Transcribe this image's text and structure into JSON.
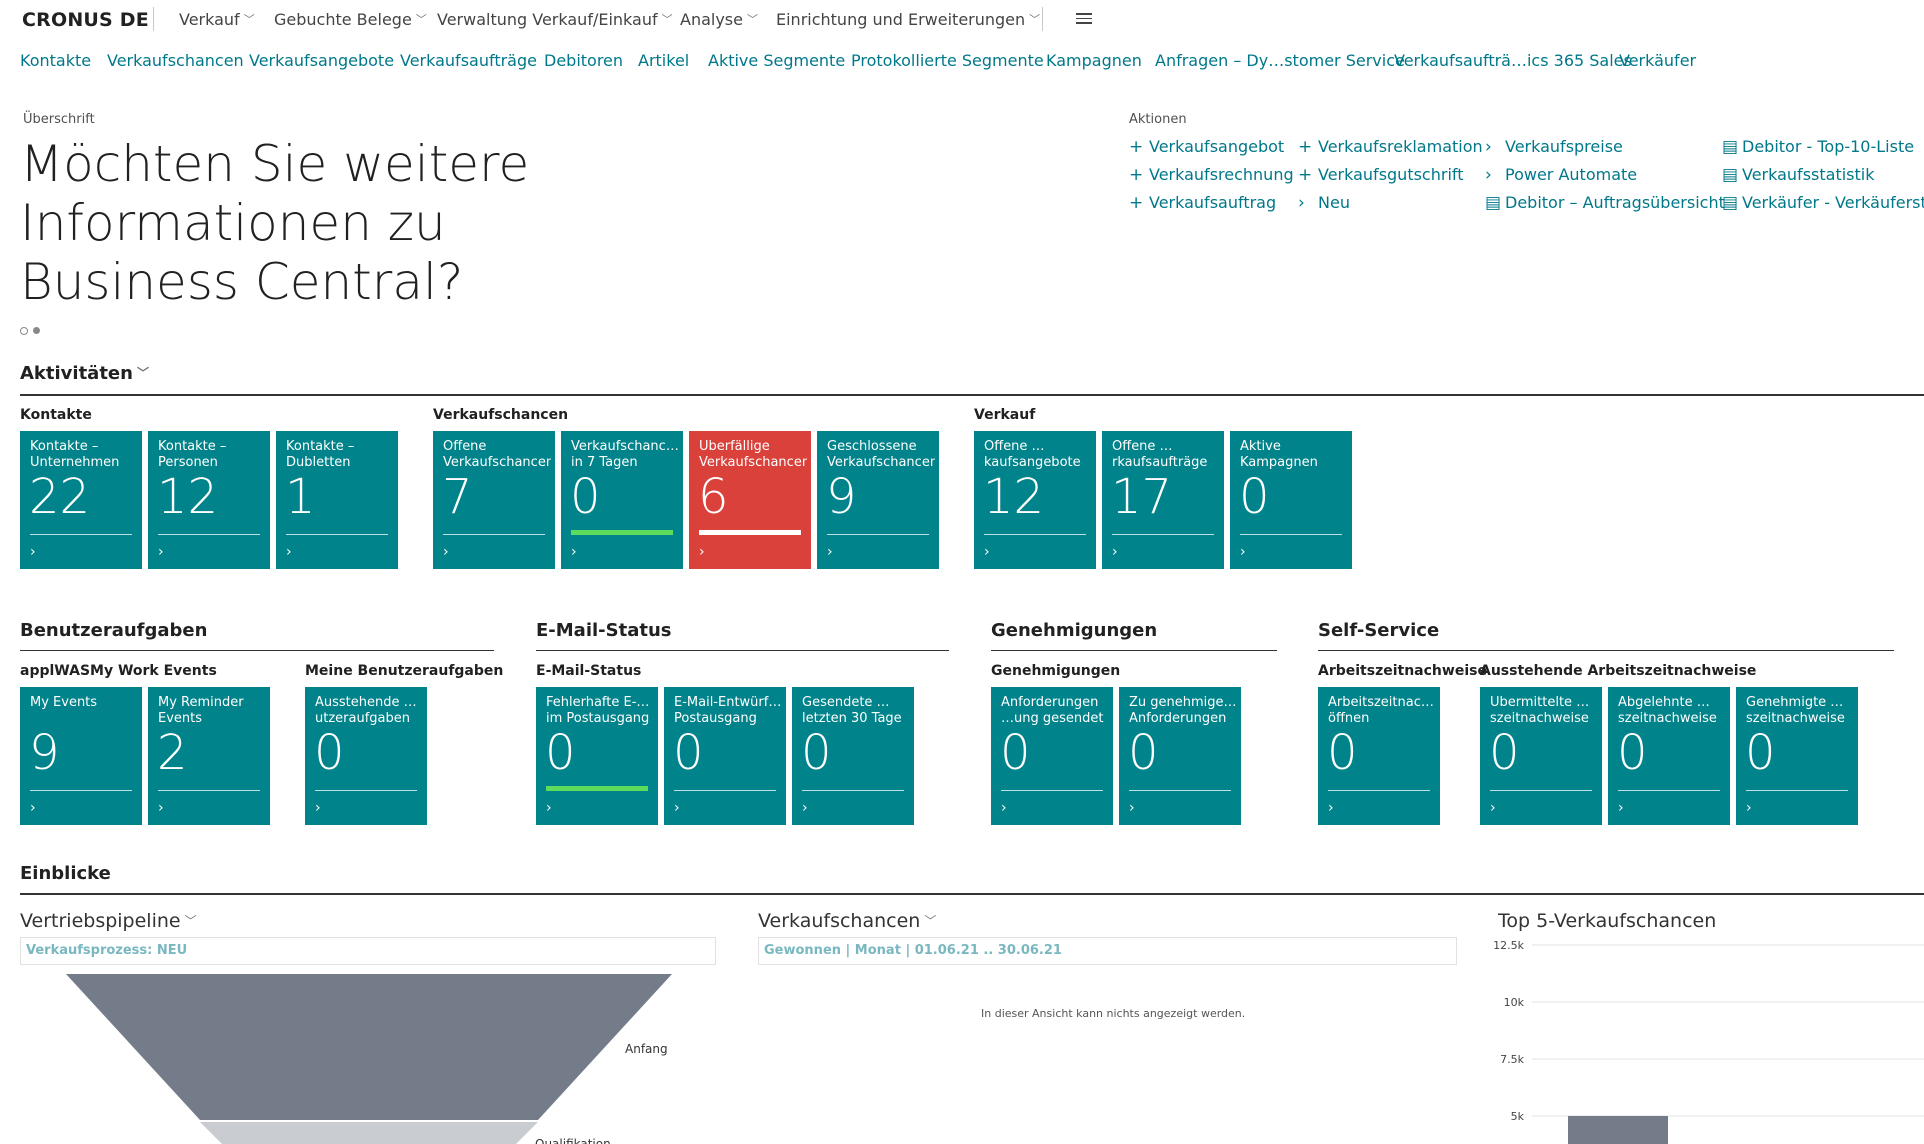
{
  "topbar": {
    "company": "CRONUS DE",
    "menus": [
      "Verkauf",
      "Gebuchte Belege",
      "Verwaltung Verkauf/Einkauf",
      "Analyse",
      "Einrichtung und Erweiterungen"
    ],
    "hamburger_icon": "hamburger-icon"
  },
  "navlinks": [
    "Kontakte",
    "Verkaufschancen",
    "Verkaufsangebote",
    "Verkaufsaufträge",
    "Debitoren",
    "Artikel",
    "Aktive Segmente",
    "Protokollierte Segmente",
    "Kampagnen",
    "Anfragen – Dy…stomer Service",
    "Verkaufsaufträ…ics 365 Sales",
    "Verkäufer"
  ],
  "headline": {
    "caption": "Überschrift",
    "text": "Möchten Sie weitere Informationen zu Business Central?"
  },
  "actions": {
    "caption": "Aktionen",
    "items": [
      {
        "icon": "plus-icon",
        "label": "Verkaufsangebot"
      },
      {
        "icon": "plus-icon",
        "label": "Verkaufsrechnung"
      },
      {
        "icon": "plus-icon",
        "label": "Verkaufsauftrag"
      },
      {
        "icon": "plus-icon",
        "label": "Verkaufsreklamation"
      },
      {
        "icon": "plus-icon",
        "label": "Verkaufsgutschrift"
      },
      {
        "icon": "chevron-right-icon",
        "label": "Neu"
      },
      {
        "icon": "chevron-right-icon",
        "label": "Verkaufspreise"
      },
      {
        "icon": "chevron-right-icon",
        "label": "Power Automate"
      },
      {
        "icon": "report-icon",
        "label": "Debitor – Auftragsübersicht"
      },
      {
        "icon": "report-icon",
        "label": "Debitor - Top-10-Liste"
      },
      {
        "icon": "report-icon",
        "label": "Verkaufsstatistik"
      },
      {
        "icon": "report-icon",
        "label": "Verkäufer - Verkäuferstatis"
      }
    ]
  },
  "activities": {
    "title": "Aktivitäten",
    "groups": [
      {
        "title": "Kontakte",
        "tiles": [
          {
            "label": "Kontakte – Unternehmen",
            "value": "22"
          },
          {
            "label": "Kontakte – Personen",
            "value": "12"
          },
          {
            "label": "Kontakte – Dubletten",
            "value": "1"
          }
        ]
      },
      {
        "title": "Verkaufschancen",
        "tiles": [
          {
            "label": "Offene Verkaufschancen",
            "value": "7"
          },
          {
            "label": "Verkaufschanc… in 7 Tagen",
            "value": "0"
          },
          {
            "label": "Überfällige Verkaufschancen",
            "value": "6"
          },
          {
            "label": "Geschlossene Verkaufschancen",
            "value": "9"
          }
        ]
      },
      {
        "title": "Verkauf",
        "tiles": [
          {
            "label": "Offene …kaufsangebote",
            "value": "12"
          },
          {
            "label": "Offene …rkaufsaufträge",
            "value": "17"
          },
          {
            "label": "Aktive Kampagnen",
            "value": "0"
          }
        ]
      }
    ]
  },
  "user_tasks": {
    "title": "Benutzeraufgaben",
    "groups": [
      {
        "title": "applWASMy Work Events",
        "tiles": [
          {
            "label": "My Events",
            "value": "9"
          },
          {
            "label": "My Reminder Events",
            "value": "2"
          }
        ]
      },
      {
        "title": "Meine Benutzeraufgaben",
        "tiles": [
          {
            "label": "Ausstehende …utzeraufgaben",
            "value": "0"
          }
        ]
      }
    ]
  },
  "email_status": {
    "title": "E-Mail-Status",
    "groups": [
      {
        "title": "E-Mail-Status",
        "tiles": [
          {
            "label": "Fehlerhafte E-… im Postausgang",
            "value": "0"
          },
          {
            "label": "E-Mail-Entwürf… Postausgang",
            "value": "0"
          },
          {
            "label": "Gesendete …letzten 30 Tage",
            "value": "0"
          }
        ]
      }
    ]
  },
  "approvals": {
    "title": "Genehmigungen",
    "groups": [
      {
        "title": "Genehmigungen",
        "tiles": [
          {
            "label": "Anforderungen …ung gesendet",
            "value": "0"
          },
          {
            "label": "Zu genehmige… Anforderungen",
            "value": "0"
          }
        ]
      }
    ]
  },
  "self_service": {
    "title": "Self-Service",
    "groups": [
      {
        "title": "Arbeitszeitnachweise",
        "tiles": [
          {
            "label": "Arbeitszeitnac… öffnen",
            "value": "0"
          }
        ]
      },
      {
        "title": "Ausstehende Arbeitszeitnachweise",
        "tiles": [
          {
            "label": "Übermittelte …szeitnachweise",
            "value": "0"
          },
          {
            "label": "Abgelehnte …szeitnachweise",
            "value": "0"
          },
          {
            "label": "Genehmigte …szeitnachweise",
            "value": "0"
          }
        ]
      }
    ]
  },
  "colors": {
    "tile": "#00838a",
    "tile_alert": "#d9413a",
    "link": "#00788a",
    "indicator_green": "#5ddc5b"
  },
  "insights": {
    "title": "Einblicke",
    "pipeline": {
      "title": "Vertriebspipeline",
      "filter": "Verkaufsprozess: NEU",
      "labels": [
        "Anfang",
        "Qualifikation"
      ]
    },
    "opportunities": {
      "title": "Verkaufschancen",
      "filter": "Gewonnen | Monat | 01.06.21 .. 30.06.21",
      "empty_text": "In dieser Ansicht kann nichts angezeigt werden."
    },
    "top5": {
      "title": "Top 5-Verkaufschancen"
    }
  },
  "chart_data": {
    "type": "bar",
    "title": "Top 5-Verkaufschancen",
    "ytick_labels": [
      "12.5k",
      "10k",
      "7.5k",
      "5k"
    ],
    "yticks": [
      12500,
      10000,
      7500,
      5000
    ],
    "ylim": [
      0,
      12500
    ],
    "grid": true
  }
}
